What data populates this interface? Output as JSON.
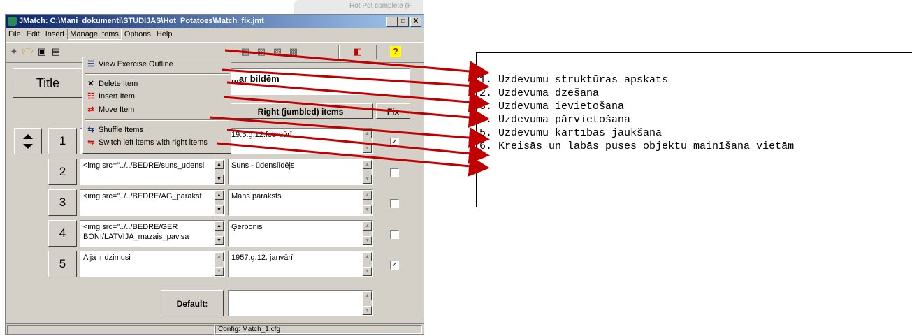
{
  "window": {
    "title": "JMatch: C:\\Mani_dokumenti\\STUDIJAS\\Hot_Potatoes\\Match_fix.jmt",
    "background_window_title": "Hot Pot complete (F",
    "buttons": [
      "_",
      "□",
      "X"
    ]
  },
  "menubar": [
    "File",
    "Edit",
    "Insert",
    "Manage Items",
    "Options",
    "Help"
  ],
  "manage_items_menu": [
    {
      "icon": "outline-icon",
      "label": "View Exercise Outline"
    },
    {
      "icon": "delete-icon",
      "label": "Delete Item"
    },
    {
      "icon": "insert-item-icon",
      "label": "Insert Item"
    },
    {
      "icon": "move-item-icon",
      "label": "Move Item"
    },
    {
      "icon": "shuffle-icon",
      "label": "Shuffle Items"
    },
    {
      "icon": "switch-icon",
      "label": "Switch left items with right items"
    }
  ],
  "toolbar": {
    "help_glyph": "?"
  },
  "exercise": {
    "title_button": "Title",
    "title_value": "...ar bildēm",
    "right_header": "Right (jumbled) items",
    "fix_header": "Fix",
    "default_label": "Default:"
  },
  "rows": [
    {
      "num": "1",
      "left": "",
      "right": "19.5.g.12.februārī",
      "fix": true
    },
    {
      "num": "2",
      "left": "<img src=\"../../BEDRE/suns_udensl",
      "right": "Suns - ūdenslīdējs",
      "fix": false
    },
    {
      "num": "3",
      "left": "<img src=\"../../BEDRE/AG_parakst",
      "right": "Mans paraksts",
      "fix": false
    },
    {
      "num": "4",
      "left": "<img src=\"../../BEDRE/GER BONI/LATVIJA_mazais_pavisa",
      "right": "Ģerbonis",
      "fix": false
    },
    {
      "num": "5",
      "left": "Aija ir dzimusi",
      "right": "1957.g.12. janvārī",
      "fix": true
    }
  ],
  "statusbar": {
    "config": "Config: Match_1.cfg"
  },
  "annotation": {
    "lines": [
      "1. Uzdevumu struktūras apskats",
      "2. Uzdevuma dzēšana",
      "3. Uzdevuma ievietošana",
      "4. Uzdevuma pārvietošana",
      "5. Uzdevumu kārtības jaukšana",
      "6. Kreisās un labās puses objektu mainīšana vietām"
    ],
    "arrow_color": "#c00000"
  }
}
